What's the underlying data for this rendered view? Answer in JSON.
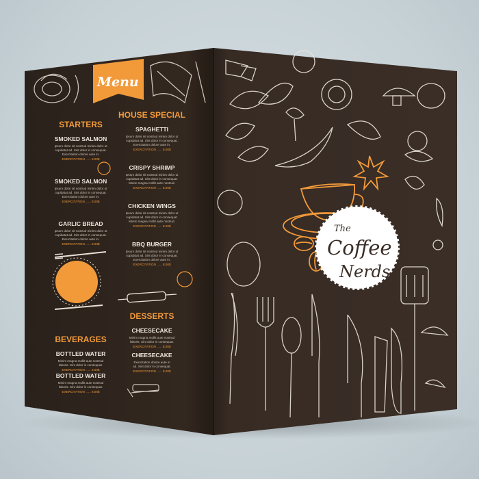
{
  "menu_label": "Menu",
  "left_panel": {
    "starters": {
      "title": "STARTERS",
      "items": [
        {
          "name": "SMOKED SALMON",
          "desc1": "Ipsum dolor nit nostrud minim dolor ut",
          "desc2": "cupidatat ad. Sint dolor in consequat.",
          "desc3": "Exercitation dolore aute in.",
          "price": "EXERCITATION ...... 8.00$"
        },
        {
          "name": "SMOKED SALMON",
          "desc1": "Ipsum dolor nit nostrud minim dolor ut",
          "desc2": "cupidatat ad. Sint dolor in consequat.",
          "desc3": "Exercitation dolore aute in.",
          "price": "EXERCITATION ...... 8.00$"
        },
        {
          "name": "GARLIC BREAD",
          "desc1": "Ipsum dolor nit nostrud minim dolor ut",
          "desc2": "cupidatat ad. Sint dolor in consequat.",
          "desc3": "Exercitation dolore aute in.",
          "price": "EXERCITATION ...... 8.00$"
        }
      ]
    },
    "beverages": {
      "title": "BEVERAGES",
      "items": [
        {
          "name": "BOTTLED WATER",
          "desc1": "Minim magna mollit aute nostrud",
          "desc2": "laboris. Sint dolor in consequat.",
          "price": "EXERCITATION ...... 8.00$"
        },
        {
          "name": "BOTTLED WATER",
          "desc1": "Minim magna mollit aute nostrud",
          "desc2": "laboris. Sint dolor in consequat.",
          "price": "EXERCITATION ...... 8.00$"
        }
      ]
    }
  },
  "right_column": {
    "house_special": {
      "title": "HOUSE SPECIAL",
      "items": [
        {
          "name": "SPAGHETTI",
          "desc1": "Ipsum dolor nit nostrud minim dolor ut",
          "desc2": "cupidatat ad. Sint dolor in consequat.",
          "desc3": "Exercitation dolore aute in.",
          "price": "EXERCITATION ...... 8.00$"
        },
        {
          "name": "CRISPY SHRIMP",
          "desc1": "Ipsum dolor nit nostrud minim dolor ut",
          "desc2": "cupidatat ad. Sint dolor in consequat.",
          "desc3": "Minim magna mollit aute nostrud.",
          "price": "EXERCITATION ...... 8.00$"
        },
        {
          "name": "CHICKEN WINGS",
          "desc1": "Ipsum dolor nit nostrud minim dolor ut",
          "desc2": "cupidatat ad. Sint dolor in consequat.",
          "desc3": "Minim magna mollit aute nostrud.",
          "price": "EXERCITATION ...... 8.00$"
        },
        {
          "name": "BBQ BURGER",
          "desc1": "Ipsum dolor nit nostrud minim dolor ut",
          "desc2": "cupidatat ad. Sint dolor in consequat.",
          "desc3": "Exercitation dolore aute in.",
          "price": "EXERCITATION ...... 8.00$"
        }
      ]
    },
    "desserts": {
      "title": "DESSERTS",
      "items": [
        {
          "name": "CHEESECAKE",
          "desc1": "Minim magna mollit aute nostrud",
          "desc2": "laboris. Sint dolor in consequat.",
          "price": "EXERCITATION ...... 8.00$"
        },
        {
          "name": "CHEESECAKE",
          "desc1": "Exercitation dolore aute in",
          "desc2": "ad. Sint dolor in consequat.",
          "price": "EXERCITATION ...... 8.00$"
        }
      ]
    }
  },
  "cover": {
    "logo_line1": "The",
    "logo_line2": "Coffee",
    "logo_line3": "Nerds"
  },
  "colors": {
    "board": "#332822",
    "board_light": "#3c302a",
    "chalk": "#ece6dc",
    "orange": "#f29a3a",
    "background": "#c9d3d8"
  }
}
